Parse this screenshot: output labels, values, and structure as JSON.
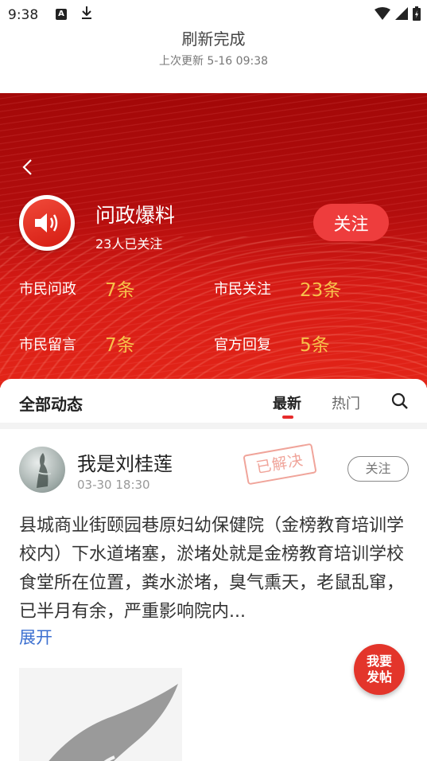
{
  "status_bar": {
    "time": "9:38",
    "notif_icon_letter": "A",
    "icons": [
      "a-notification-icon",
      "download-icon",
      "wifi-icon",
      "signal-icon",
      "battery-icon"
    ]
  },
  "refresh": {
    "title": "刷新完成",
    "subtitle": "上次更新 5-16 09:38"
  },
  "topic": {
    "title": "问政爆料",
    "followers": "23人已关注",
    "follow_label": "关注",
    "stats": [
      {
        "label": "市民问政",
        "value": "7条"
      },
      {
        "label": "市民关注",
        "value": "23条"
      },
      {
        "label": "市民留言",
        "value": "7条"
      },
      {
        "label": "官方回复",
        "value": "5条"
      }
    ]
  },
  "feed": {
    "section_title": "全部动态",
    "tabs": [
      {
        "label": "最新",
        "active": true
      },
      {
        "label": "热门",
        "active": false
      }
    ]
  },
  "post": {
    "username": "我是刘桂莲",
    "time": "03-30 18:30",
    "stamp": "已解决",
    "follow_label": "关注",
    "body": "县城商业街颐园巷原妇幼保健院（金榜教育培训学校内）下水道堵塞，淤堵处就是金榜教育培训学校食堂所在位置，粪水淤堵，臭气熏天，老鼠乱窜，已半月有余，严重影响院内...",
    "expand_label": "展开"
  },
  "fab": {
    "line1": "我要",
    "line2": "发帖"
  },
  "colors": {
    "banner_red": "#b20d0d",
    "stat_gold": "#f7c14a",
    "accent_red": "#e62b2b",
    "link_blue": "#3b6fd0"
  }
}
